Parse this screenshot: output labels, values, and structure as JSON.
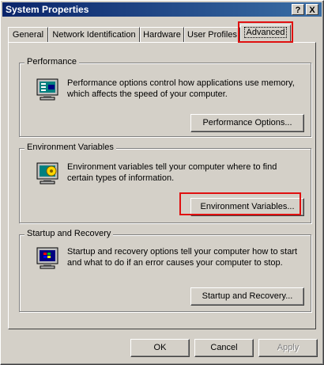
{
  "window": {
    "title": "System Properties",
    "help_button": "?",
    "close_button": "X"
  },
  "tabs": [
    {
      "label": "General"
    },
    {
      "label": "Network Identification"
    },
    {
      "label": "Hardware"
    },
    {
      "label": "User Profiles"
    },
    {
      "label": "Advanced",
      "selected": true
    }
  ],
  "performance": {
    "title": "Performance",
    "text": "Performance options control how applications use memory, which affects the speed of your computer.",
    "button": "Performance Options...",
    "icon": "performance-monitor-icon"
  },
  "environment": {
    "title": "Environment Variables",
    "text": "Environment variables tell your computer where to find certain types of information.",
    "button": "Environment Variables...",
    "icon": "environment-monitor-icon"
  },
  "startup": {
    "title": "Startup and Recovery",
    "text": "Startup and recovery options tell your computer how to start and what to do if an error causes your computer to stop.",
    "button": "Startup and Recovery...",
    "icon": "windows-monitor-icon"
  },
  "footer": {
    "ok": "OK",
    "cancel": "Cancel",
    "apply": "Apply"
  },
  "colors": {
    "titlebar_start": "#0a246a",
    "titlebar_end": "#3a6ea5",
    "face": "#d4d0c8",
    "highlight": "#e01010"
  }
}
